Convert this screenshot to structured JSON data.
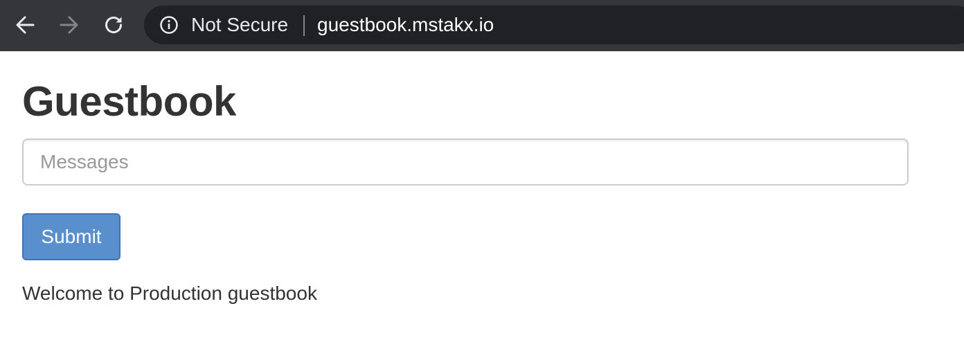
{
  "browser": {
    "back_icon": "arrow-left-icon",
    "forward_icon": "arrow-right-icon",
    "reload_icon": "reload-icon",
    "security_icon": "info-circle-icon",
    "security_label": "Not Secure",
    "url": "guestbook.mstakx.io",
    "toolbar_color": "#35363a",
    "omnibox_color": "#202124"
  },
  "page": {
    "title": "Guestbook",
    "message_input": {
      "placeholder": "Messages",
      "value": ""
    },
    "submit_label": "Submit",
    "submit_color": "#5a8fce",
    "entries": [
      "Welcome to Production guestbook"
    ]
  }
}
